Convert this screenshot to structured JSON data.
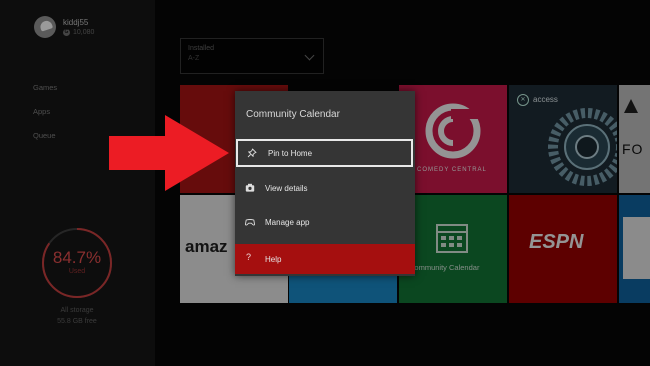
{
  "profile": {
    "gamertag": "kiddj55",
    "gamerscore": "10,080"
  },
  "nav": {
    "games": "Games",
    "apps": "Apps",
    "queue": "Queue"
  },
  "storage": {
    "percent": "84.7%",
    "used_label": "Used",
    "fraction_used": 0.847,
    "all_storage": "All storage",
    "free": "55.8 GB free"
  },
  "sort": {
    "label": "Installed",
    "value": "A-Z"
  },
  "tiles": {
    "comedy_central": {
      "text": "COMEDY CENTRAL"
    },
    "access": {
      "text": "access"
    },
    "forza": {
      "text": "FO"
    },
    "amazon": {
      "text": "amaz"
    },
    "community": {
      "text": "Community Calendar"
    },
    "espn": {
      "text": "ESPN"
    }
  },
  "context_menu": {
    "title": "Community Calendar",
    "items": [
      {
        "label": "Pin to Home",
        "icon": "pin-icon",
        "focused": true
      },
      {
        "label": "View details",
        "icon": "details-icon"
      },
      {
        "label": "Manage app",
        "icon": "gamepad-icon"
      },
      {
        "label": "Help",
        "icon": "help-icon"
      }
    ]
  },
  "colors": {
    "accent_red": "#a50f0f",
    "arrow_red": "#ec1c24",
    "storage_red": "#8a2f2f"
  }
}
